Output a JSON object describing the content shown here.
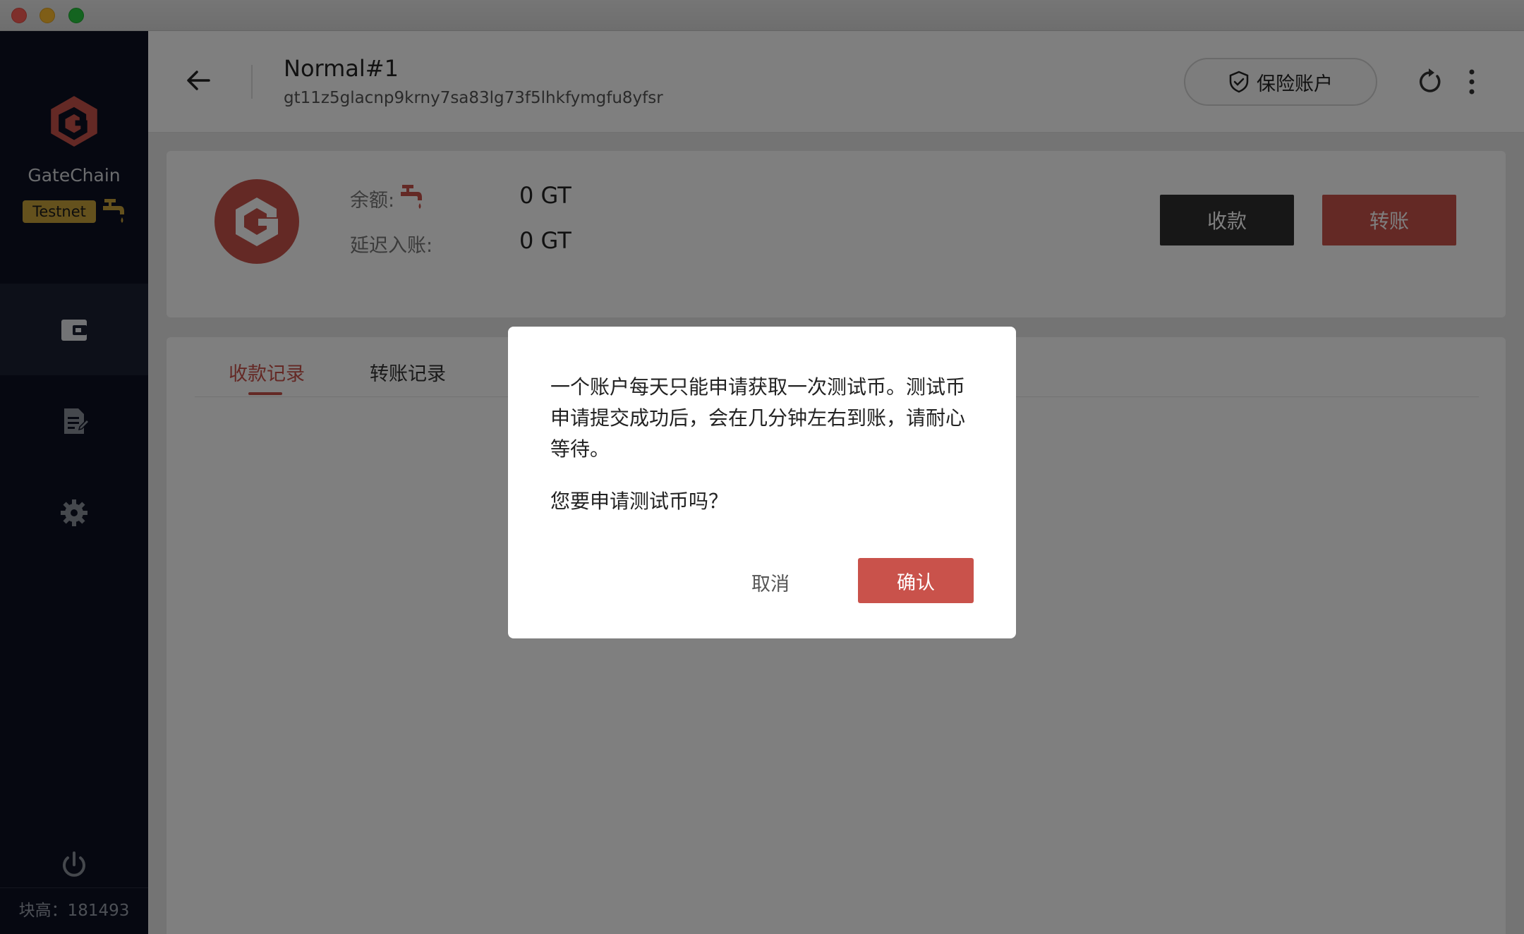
{
  "window": {
    "controls": [
      "close",
      "minimize",
      "zoom"
    ]
  },
  "sidebar": {
    "brand_name": "GateChain",
    "network_badge": "Testnet",
    "faucet_icon": "faucet-icon",
    "nav": [
      {
        "name": "wallet",
        "icon": "wallet-icon",
        "active": true
      },
      {
        "name": "document",
        "icon": "document-edit-icon",
        "active": false
      },
      {
        "name": "settings",
        "icon": "gear-icon",
        "active": false
      },
      {
        "name": "power",
        "icon": "power-icon",
        "active": false
      }
    ],
    "block_height": "块高：181493"
  },
  "header": {
    "wallet_name": "Normal#1",
    "wallet_address": "gt11z5glacnp9krny7sa83lg73f5lhkfymgfu8yfsr",
    "insurance_label": "保险账户"
  },
  "balance": {
    "balance_label": "余额:",
    "balance_value": "0 GT",
    "delayed_label": "延迟入账:",
    "delayed_value": "0 GT",
    "receive_label": "收款",
    "transfer_label": "转账"
  },
  "records": {
    "tabs": [
      {
        "label": "收款记录",
        "active": true
      },
      {
        "label": "转账记录",
        "active": false
      }
    ]
  },
  "dialog": {
    "message": "一个账户每天只能申请获取一次测试币。测试币申请提交成功后，会在几分钟左右到账，请耐心等待。",
    "question": "您要申请测试币吗？",
    "cancel_label": "取消",
    "confirm_label": "确认"
  },
  "colors": {
    "accent": "#c9524b",
    "sidebar_bg": "#0c1122",
    "badge": "#c9a23b",
    "dark_button": "#2f2f2f"
  }
}
